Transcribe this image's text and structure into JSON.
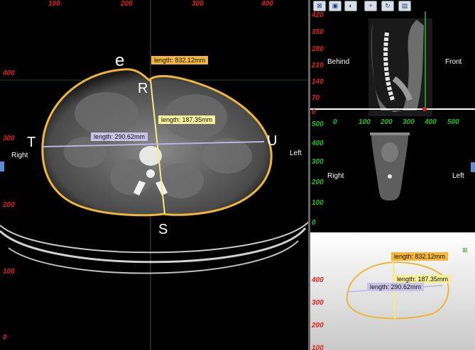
{
  "main_view": {
    "top_ruler": [
      "100",
      "200",
      "300",
      "400"
    ],
    "left_ruler": [
      "400",
      "300",
      "200",
      "100",
      "0"
    ],
    "orientation": {
      "right": "Right",
      "left": "Left"
    },
    "landmarks": {
      "e": "e",
      "R": "R",
      "S": "S",
      "T": "T",
      "U": "U"
    },
    "measurements": {
      "circumference": "length:  832.12mm",
      "ap": "length:  187.35mm",
      "lateral": "length:  290.62mm"
    }
  },
  "toolbar": {
    "buttons": [
      "view-icon",
      "window-icon",
      "contrast-icon",
      "crosshair-icon",
      "rotate-icon",
      "layout-icon"
    ]
  },
  "sagittal_view": {
    "top_ruler": [
      "400"
    ],
    "left_ruler": [
      "420",
      "350",
      "280",
      "210",
      "140",
      "70",
      "0"
    ],
    "orientation": {
      "behind": "Behind",
      "front": "Front"
    }
  },
  "coronal_view": {
    "top_ruler": [
      "0",
      "100",
      "200",
      "300",
      "400",
      "500"
    ],
    "left_ruler": [
      "500",
      "400",
      "300",
      "200",
      "100",
      "0"
    ],
    "orientation": {
      "right": "Right",
      "left": "Left"
    }
  },
  "preview_view": {
    "left_ruler": [
      "400",
      "300",
      "200",
      "100"
    ],
    "measurements": {
      "circumference": "length:  832.12mm",
      "ap": "length:  187.35mm",
      "lateral": "length:  290.62mm"
    }
  },
  "colors": {
    "ruler_red": "#e02020",
    "ruler_green": "#22c022",
    "outline_orange": "#f0b63a",
    "ap_line": "#f3ed7a",
    "lateral_line": "#b9b4e6",
    "tab_blue": "#5a8fd6"
  }
}
